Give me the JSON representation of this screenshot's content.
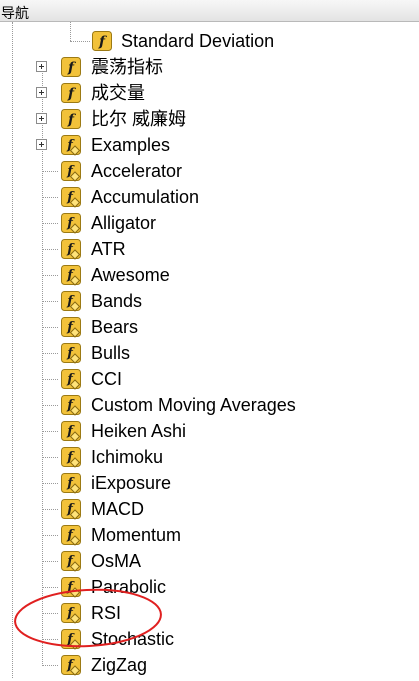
{
  "header": {
    "title": "导航"
  },
  "tree": {
    "top_item": {
      "label": "Standard Deviation",
      "icon": "function-icon"
    },
    "folders": [
      {
        "label": "震荡指标",
        "icon": "function-folder-icon"
      },
      {
        "label": "成交量",
        "icon": "function-folder-icon"
      },
      {
        "label": "比尔 威廉姆",
        "icon": "function-folder-icon"
      },
      {
        "label": "Examples",
        "icon": "custom-indicator-folder-icon"
      }
    ],
    "indicators": [
      {
        "label": "Accelerator"
      },
      {
        "label": "Accumulation"
      },
      {
        "label": "Alligator"
      },
      {
        "label": "ATR"
      },
      {
        "label": "Awesome"
      },
      {
        "label": "Bands"
      },
      {
        "label": "Bears"
      },
      {
        "label": "Bulls"
      },
      {
        "label": "CCI"
      },
      {
        "label": "Custom Moving Averages"
      },
      {
        "label": "Heiken Ashi"
      },
      {
        "label": "Ichimoku"
      },
      {
        "label": "iExposure"
      },
      {
        "label": "MACD"
      },
      {
        "label": "Momentum"
      },
      {
        "label": "OsMA"
      },
      {
        "label": "Parabolic"
      },
      {
        "label": "RSI",
        "highlighted": true
      },
      {
        "label": "Stochastic"
      },
      {
        "label": "ZigZag"
      }
    ]
  },
  "colors": {
    "icon_fill": "#f2c23a",
    "icon_border": "#9c7a14",
    "annotation": "#e02020",
    "connector": "#9a9a9a"
  }
}
